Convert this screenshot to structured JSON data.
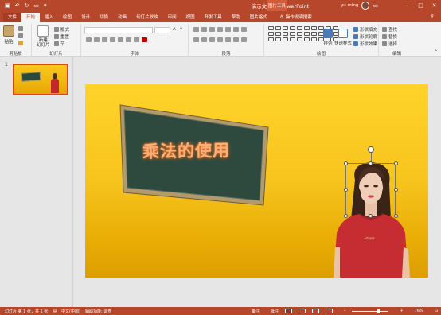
{
  "app": {
    "title": "演示文稿1 - PowerPoint",
    "context_tab_group": "图片工具",
    "user_name": "yu ming"
  },
  "tabs": [
    "文件",
    "开始",
    "插入",
    "绘图",
    "设计",
    "切换",
    "动画",
    "幻灯片放映",
    "审阅",
    "视图",
    "开发工具",
    "帮助",
    "图片格式"
  ],
  "tell_me": "操作说明搜索",
  "ribbon": {
    "clipboard": {
      "label": "剪贴板",
      "paste": "粘贴"
    },
    "slides": {
      "label": "幻灯片",
      "new_slide": "新建\n幻灯片",
      "layout": "版式",
      "reset": "重置",
      "section": "节"
    },
    "font": {
      "label": "字体"
    },
    "paragraph": {
      "label": "段落"
    },
    "drawing": {
      "label": "绘图",
      "arrange": "排列",
      "quick_styles": "快速样式",
      "shape_fill": "形状填充",
      "shape_outline": "形状轮廓",
      "shape_effects": "形状效果"
    },
    "editing": {
      "label": "编辑",
      "find": "查找",
      "replace": "替换",
      "select": "选择"
    }
  },
  "slide_panel": {
    "slide_number": "1"
  },
  "slide": {
    "board_text": "乘法的使用"
  },
  "status": {
    "slide_count": "幻灯片 第 1 张，共 1 张",
    "language": "中文(中国)",
    "accessibility": "辅助功能: 调查",
    "notes": "备注",
    "comments": "批注",
    "zoom": "76%"
  },
  "colors": {
    "accent": "#b7472a",
    "slide_bg_top": "#ffd32a",
    "slide_bg_bottom": "#dd9e00"
  }
}
